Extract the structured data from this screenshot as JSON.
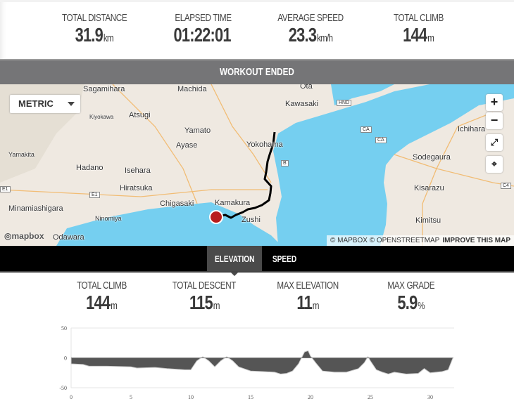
{
  "summary": {
    "items": [
      {
        "label": "TOTAL DISTANCE",
        "value": "31.9",
        "unit": "km"
      },
      {
        "label": "ELAPSED TIME",
        "value": "01:22:01",
        "unit": ""
      },
      {
        "label": "AVERAGE SPEED",
        "value": "23.3",
        "unit": "km/h"
      },
      {
        "label": "TOTAL CLIMB",
        "value": "144",
        "unit": "m"
      }
    ]
  },
  "banner": "WORKOUT ENDED",
  "map": {
    "units_select": "METRIC",
    "zoom_in": "+",
    "zoom_out": "−",
    "labels": [
      "Sagamihara",
      "Machida",
      "Ota",
      "Kawasaki",
      "Kiyokawa",
      "Atsugi",
      "Yamato",
      "Yokohama",
      "Ichihara",
      "Yamakita",
      "Ayase",
      "Sodegaura",
      "Hadano",
      "Isehara",
      "Hiratsuka",
      "Kisarazu",
      "Minamiashigara",
      "Chigasaki",
      "Kamakura",
      "Zushi",
      "Ninomiya",
      "Odawara",
      "Kimitsu"
    ],
    "shields": [
      "HND",
      "CA",
      "CA",
      "B",
      "E1",
      "E1",
      "C4"
    ],
    "logo": "mapbox",
    "attribution": "© MAPBOX © OPENSTREETMAP",
    "improve": "IMPROVE THIS MAP",
    "colors": {
      "land": "#efe9e1",
      "water": "#75cff0",
      "route": "#000000",
      "marker": "#b81c1c"
    }
  },
  "tabs": [
    "ELEVATION",
    "SPEED"
  ],
  "elevation_stats": {
    "items": [
      {
        "label": "TOTAL CLIMB",
        "value": "144",
        "unit": "m"
      },
      {
        "label": "TOTAL DESCENT",
        "value": "115",
        "unit": "m"
      },
      {
        "label": "MAX ELEVATION",
        "value": "11",
        "unit": "m"
      },
      {
        "label": "MAX GRADE",
        "value": "5.9",
        "unit": "%"
      }
    ]
  },
  "chart_data": {
    "type": "area",
    "xlabel": "",
    "ylabel": "",
    "xlim": [
      0,
      32
    ],
    "ylim": [
      -50,
      50
    ],
    "xticks": [
      "0",
      "5",
      "10",
      "15",
      "20",
      "25",
      "30"
    ],
    "yticks": [
      "50",
      "0",
      "-50"
    ],
    "grid": true,
    "x": [
      0,
      1,
      1.5,
      3,
      5,
      5.5,
      7,
      8,
      9.5,
      10,
      10.5,
      11,
      11.5,
      12,
      12.5,
      13,
      13.5,
      14,
      15,
      16,
      17,
      17.5,
      18,
      18.5,
      19,
      19.5,
      19.8,
      20,
      20.5,
      21,
      22,
      23,
      24,
      24.5,
      24.8,
      25,
      25.5,
      26,
      26.5,
      27,
      28,
      29,
      29.5,
      30,
      31,
      31.5,
      31.9
    ],
    "y": [
      -10,
      -11,
      -14,
      -14,
      -15,
      -17,
      -16,
      -18,
      -20,
      -20,
      -5,
      2,
      -5,
      -15,
      -5,
      2,
      -5,
      -15,
      -22,
      -23,
      -24,
      -27,
      -26,
      -22,
      -10,
      10,
      12,
      3,
      -10,
      -22,
      -24,
      -24,
      -18,
      -8,
      2,
      -5,
      -20,
      -24,
      -27,
      -24,
      -27,
      -26,
      -18,
      -25,
      -23,
      -20,
      0
    ],
    "color": "#555555"
  }
}
